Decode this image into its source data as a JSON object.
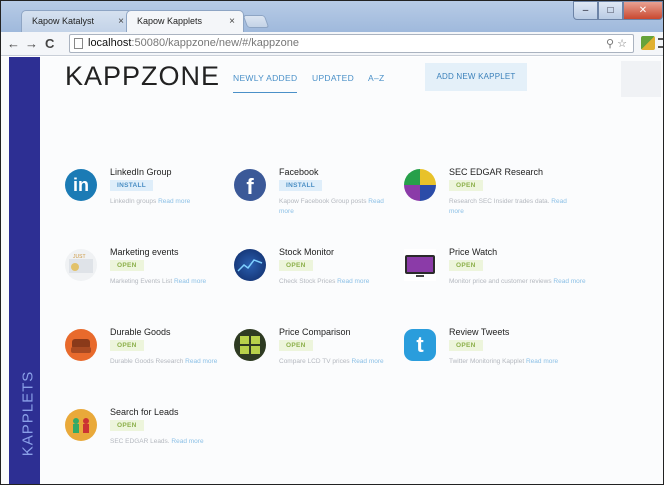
{
  "browser": {
    "tabs": [
      {
        "label": "Kapow Katalyst Managem"
      },
      {
        "label": "Kapow Kapplets"
      }
    ],
    "url_host": "localhost",
    "url_rest": ":50080/kappzone/new/#/kappzone",
    "nav": {
      "back": "←",
      "forward": "→",
      "reload": "C"
    }
  },
  "app": {
    "logo": "KAPPZONE",
    "nav": [
      {
        "label": "NEWLY ADDED"
      },
      {
        "label": "UPDATED"
      },
      {
        "label": "A–Z"
      }
    ],
    "add_button": "ADD NEW KAPPLET",
    "sidebar_label": "KAPPLETS"
  },
  "kapplets": [
    {
      "name": "LinkedIn Group",
      "badge": "INSTALL",
      "desc": "LinkedIn groups",
      "more": "Read more",
      "icon": "linkedin-icon"
    },
    {
      "name": "Facebook",
      "badge": "INSTALL",
      "desc": "Kapow Facebook Group posts",
      "more": "Read more",
      "icon": "facebook-icon"
    },
    {
      "name": "SEC EDGAR Research",
      "badge": "OPEN",
      "desc": "Research SEC Insider trades data.",
      "more": "Read more",
      "icon": "sec-pie-icon"
    },
    {
      "name": "Marketing events",
      "badge": "OPEN",
      "desc": "Marketing Events List",
      "more": "Read more",
      "icon": "marketing-icon"
    },
    {
      "name": "Stock Monitor",
      "badge": "OPEN",
      "desc": "Check Stock Prices",
      "more": "Read more",
      "icon": "stock-icon"
    },
    {
      "name": "Price Watch",
      "badge": "OPEN",
      "desc": "Monitor price and customer reviews",
      "more": "Read more",
      "icon": "tv-icon"
    },
    {
      "name": "Durable Goods",
      "badge": "OPEN",
      "desc": "Durable Goods Research",
      "more": "Read more",
      "icon": "sofa-icon"
    },
    {
      "name": "Price Comparison",
      "badge": "OPEN",
      "desc": "Compare LCD TV prices",
      "more": "Read more",
      "icon": "price-compare-icon"
    },
    {
      "name": "Review Tweets",
      "badge": "OPEN",
      "desc": "Twitter Monitoring Kapplet",
      "more": "Read more",
      "icon": "twitter-icon"
    },
    {
      "name": "Search for Leads",
      "badge": "OPEN",
      "desc": "SEC EDGAR Leads.",
      "more": "Read more",
      "icon": "leads-icon"
    }
  ]
}
